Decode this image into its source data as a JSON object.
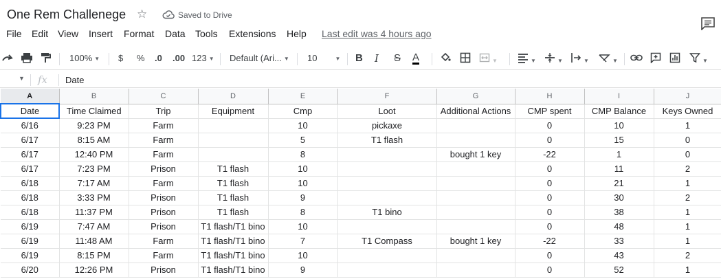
{
  "doc": {
    "title": "One Rem Challenege",
    "saved_status": "Saved to Drive",
    "last_edit": "Last edit was 4 hours ago"
  },
  "menu": [
    "File",
    "Edit",
    "View",
    "Insert",
    "Format",
    "Data",
    "Tools",
    "Extensions",
    "Help"
  ],
  "toolbar": {
    "zoom": "100%",
    "currency": "$",
    "percent": "%",
    "decrease_decimal": ".0",
    "increase_decimal": ".00",
    "more_formats": "123",
    "font": "Default (Ari...",
    "font_size": "10",
    "bold": "B",
    "italic": "I",
    "strikethrough": "S",
    "text_color": "A"
  },
  "formula_bar": {
    "fx": "fx",
    "value": "Date"
  },
  "grid": {
    "columns": [
      "A",
      "B",
      "C",
      "D",
      "E",
      "F",
      "G",
      "H",
      "I",
      "J"
    ],
    "selected_column": "A",
    "headers": [
      "Date",
      "Time Claimed",
      "Trip",
      "Equipment",
      "Cmp",
      "Loot",
      "Additional Actions",
      "CMP spent",
      "CMP Balance",
      "Keys Owned"
    ],
    "rows": [
      [
        "6/16",
        "9:23 PM",
        "Farm",
        "",
        "10",
        "pickaxe",
        "",
        "0",
        "10",
        "1"
      ],
      [
        "6/17",
        "8:15 AM",
        "Farm",
        "",
        "5",
        "T1 flash",
        "",
        "0",
        "15",
        "0"
      ],
      [
        "6/17",
        "12:40 PM",
        "Farm",
        "",
        "8",
        "",
        "bought 1 key",
        "-22",
        "1",
        "0"
      ],
      [
        "6/17",
        "7:23 PM",
        "Prison",
        "T1 flash",
        "10",
        "",
        "",
        "0",
        "11",
        "2"
      ],
      [
        "6/18",
        "7:17 AM",
        "Farm",
        "T1 flash",
        "10",
        "",
        "",
        "0",
        "21",
        "1"
      ],
      [
        "6/18",
        "3:33 PM",
        "Prison",
        "T1 flash",
        "9",
        "",
        "",
        "0",
        "30",
        "2"
      ],
      [
        "6/18",
        "11:37 PM",
        "Prison",
        "T1 flash",
        "8",
        "T1 bino",
        "",
        "0",
        "38",
        "1"
      ],
      [
        "6/19",
        "7:47 AM",
        "Prison",
        "T1 flash/T1 bino",
        "10",
        "",
        "",
        "0",
        "48",
        "1"
      ],
      [
        "6/19",
        "11:48 AM",
        "Farm",
        "T1 flash/T1 bino",
        "7",
        "T1 Compass",
        "bought 1 key",
        "-22",
        "33",
        "1"
      ],
      [
        "6/19",
        "8:15 PM",
        "Farm",
        "T1 flash/T1 bino",
        "10",
        "",
        "",
        "0",
        "43",
        "2"
      ],
      [
        "6/20",
        "12:26 PM",
        "Prison",
        "T1 flash/T1 bino",
        "9",
        "",
        "",
        "0",
        "52",
        "1"
      ]
    ]
  },
  "colors": {
    "selection": "#1a73e8",
    "header_bg": "#f8f9fa",
    "gridline": "#e2e3e3"
  }
}
